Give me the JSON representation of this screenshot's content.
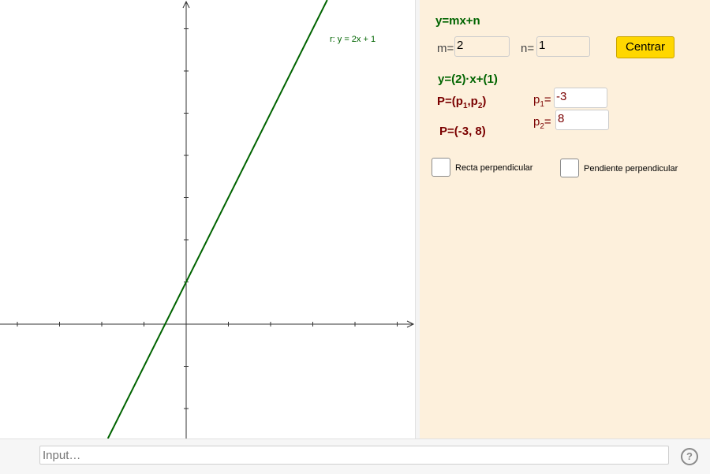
{
  "graphics": {
    "line_label": "r: y = 2x + 1",
    "point_label": "P",
    "colors": {
      "line": "#006400",
      "point": "#8b0000",
      "axes": "#333333"
    },
    "line": {
      "slope": 2,
      "intercept": 1
    },
    "point": {
      "x": -3,
      "y": 8
    }
  },
  "panel": {
    "heading": "y=mx+n",
    "m_label": "m=",
    "m_value": "2",
    "n_label": "n=",
    "n_value": "1",
    "center_button": "Centrar",
    "equation": "y=(2)·x+(1)",
    "point_def": {
      "prefix": "P=(p",
      "sub1": "1",
      "mid": ",p",
      "sub2": "2",
      "suffix": ")"
    },
    "p1_label": {
      "base": "p",
      "sub": "1",
      "eq": "="
    },
    "p1_value": "-3",
    "p2_label": {
      "base": "p",
      "sub": "2",
      "eq": "="
    },
    "p2_value": "8",
    "point_value": "P=(-3, 8)",
    "checkbox_perp_line": "Recta perpendicular",
    "checkbox_perp_slope": "Pendiente perpendicular"
  },
  "input_bar": {
    "placeholder": "Input…",
    "help_icon": "?"
  }
}
